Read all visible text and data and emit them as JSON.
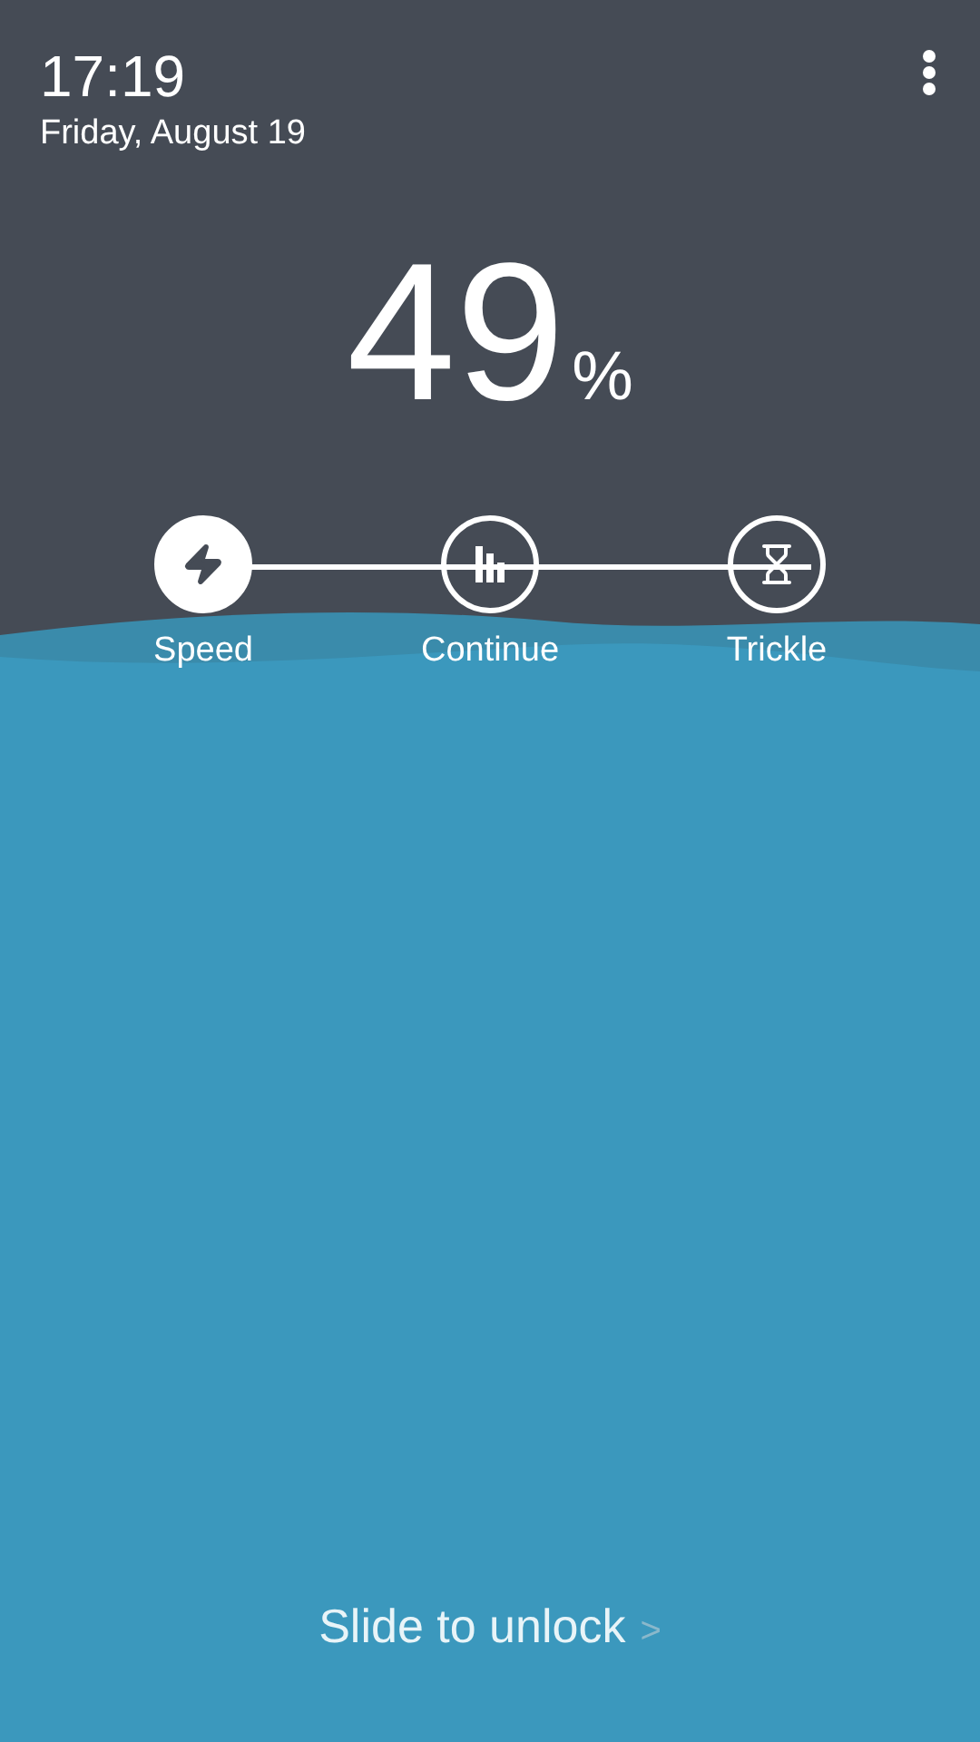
{
  "clock": {
    "time": "17:19",
    "date": "Friday, August 19"
  },
  "battery": {
    "percent": "49",
    "unit": "%"
  },
  "charge_modes": [
    {
      "label": "Speed",
      "kind": "speed",
      "selected": true
    },
    {
      "label": "Continue",
      "kind": "continue",
      "selected": false
    },
    {
      "label": "Trickle",
      "kind": "trickle",
      "selected": false
    }
  ],
  "unlock": {
    "label": "Slide to unlock",
    "arrow": ">"
  }
}
